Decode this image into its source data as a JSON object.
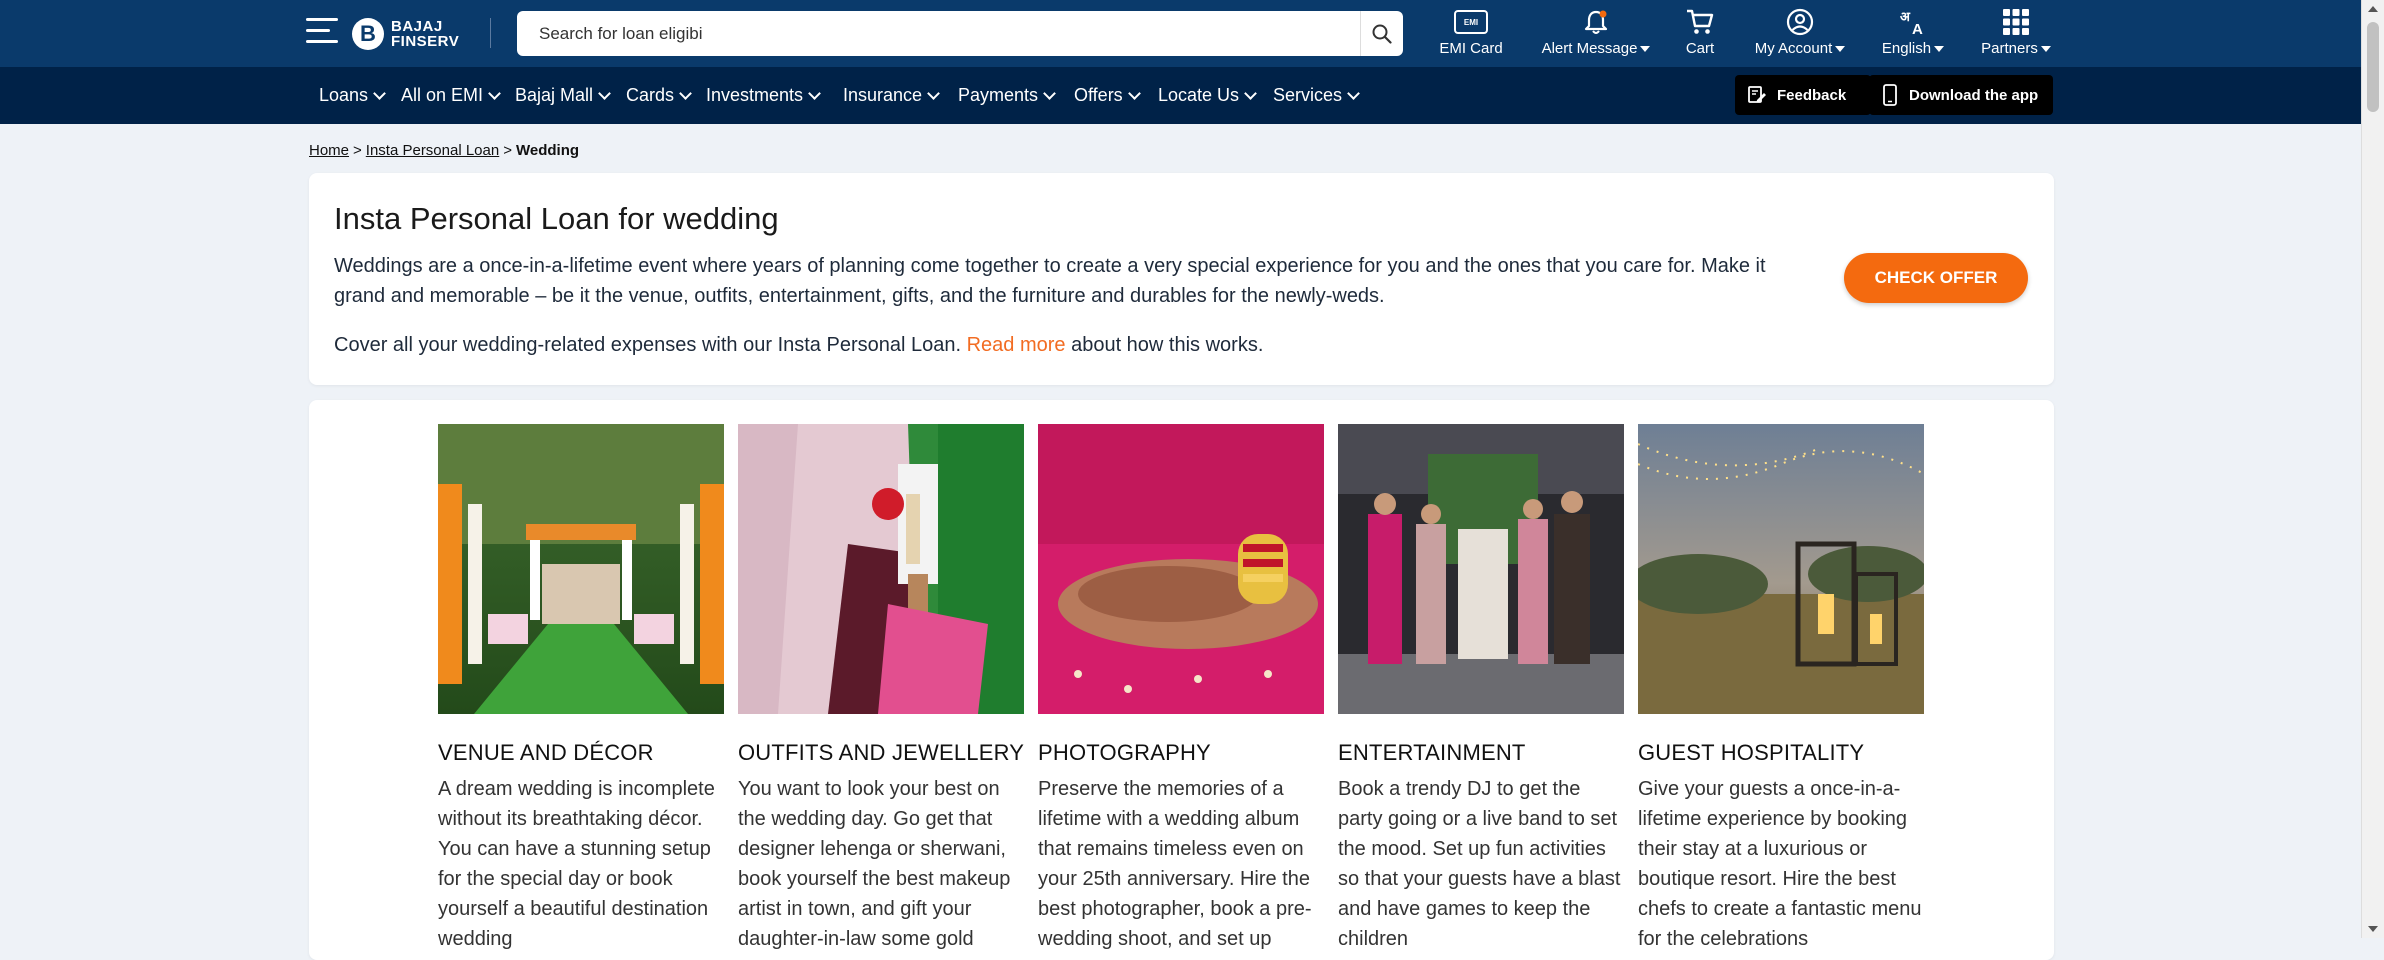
{
  "header": {
    "logo_text_line1": "BAJAJ",
    "logo_text_line2": "FINSERV",
    "search_placeholder": "Search for loan eligibi",
    "items": [
      {
        "label": "EMI Card",
        "icon": "emi-card-icon"
      },
      {
        "label": "Alert Message",
        "icon": "bell-icon"
      },
      {
        "label": "Cart",
        "icon": "cart-icon"
      },
      {
        "label": "My Account",
        "icon": "user-icon"
      },
      {
        "label": "English",
        "icon": "language-icon"
      },
      {
        "label": "Partners",
        "icon": "grid-icon"
      }
    ],
    "emi_badge": "EMI"
  },
  "nav": {
    "items": [
      "Loans",
      "All on EMI",
      "Bajaj Mall",
      "Cards",
      "Investments",
      "Insurance",
      "Payments",
      "Offers",
      "Locate Us",
      "Services"
    ],
    "feedback_label": "Feedback",
    "download_label": "Download the app"
  },
  "breadcrumb": {
    "home": "Home",
    "parent": "Insta Personal Loan",
    "current": "Wedding",
    "sep": ">"
  },
  "intro": {
    "title": "Insta Personal Loan for wedding",
    "paragraph1": "Weddings are a once-in-a-lifetime event where years of planning come together to create a very special experience for you and the ones that you care for. Make it grand and memorable – be it the venue, outfits, entertainment, gifts, and the furniture and durables for the newly-weds.",
    "paragraph2_before": "Cover all your wedding-related expenses with our Insta Personal Loan. ",
    "paragraph2_link": "Read more",
    "paragraph2_after": " about how this works.",
    "cta_label": "CHECK OFFER"
  },
  "tiles": [
    {
      "title": "VENUE AND DÉCOR",
      "text": "A dream wedding is incomplete without its breathtaking décor. You can have a stunning setup for the special day or book yourself a beautiful destination wedding"
    },
    {
      "title": "OUTFITS AND JEWELLERY",
      "text": "You want to look your best on the wedding day. Go get that designer lehenga or sherwani, book yourself the best makeup artist in town, and gift your daughter-in-law some gold"
    },
    {
      "title": "PHOTOGRAPHY",
      "text": "Preserve the memories of a lifetime with a wedding album that remains timeless even on your 25th anniversary. Hire the best photographer, book a pre-wedding shoot, and set up"
    },
    {
      "title": "ENTERTAINMENT",
      "text": "Book a trendy DJ to get the party going or a live band to set the mood. Set up fun activities so that your guests have a blast and have games to keep the children"
    },
    {
      "title": "GUEST HOSPITALITY",
      "text": "Give your guests a once-in-a-lifetime experience by booking their stay at a luxurious or boutique resort. Hire the best chefs to create a fantastic menu for the celebrations"
    }
  ],
  "colors": {
    "header_bg": "#0a3a6b",
    "nav_bg": "#002248",
    "accent": "#f46a0f",
    "page_bg": "#eef2f7"
  }
}
